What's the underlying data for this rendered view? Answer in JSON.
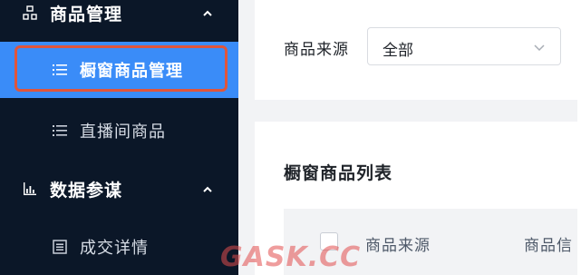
{
  "sidebar": {
    "groups": [
      {
        "label": "商品管理",
        "icon": "product-tree-icon",
        "expanded": true
      },
      {
        "label": "数据参谋",
        "icon": "bar-chart-icon",
        "expanded": true
      }
    ],
    "items": [
      {
        "label": "橱窗商品管理",
        "icon": "list-icon",
        "active": true
      },
      {
        "label": "直播间商品",
        "icon": "list-icon",
        "active": false
      },
      {
        "label": "成交详情",
        "icon": "document-icon",
        "active": false
      }
    ]
  },
  "filter": {
    "label": "商品来源",
    "value": "全部"
  },
  "list": {
    "title": "橱窗商品列表",
    "columns": [
      "商品来源",
      "商品信"
    ]
  },
  "watermark": "GASK.CC",
  "colors": {
    "sidebar_bg": "#0b1728",
    "active_bg": "#3a8cf8",
    "highlight": "#e0553b"
  }
}
